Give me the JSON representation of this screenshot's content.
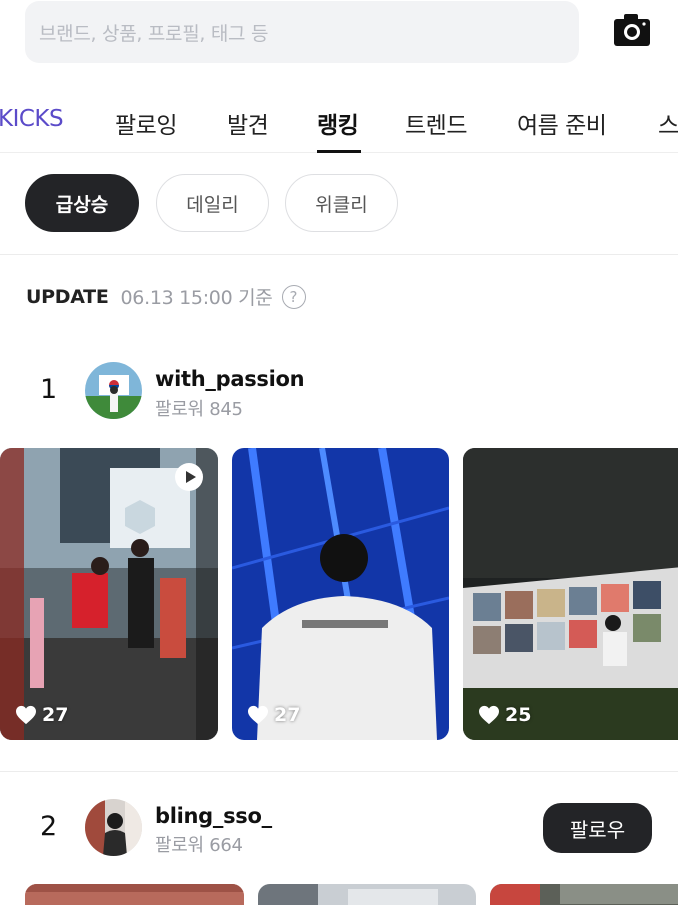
{
  "search": {
    "placeholder": "브랜드, 상품, 프로필, 태그 등"
  },
  "icons": {
    "camera": "camera-icon",
    "help": "question-circle-icon",
    "heart": "heart-icon",
    "play": "play-icon"
  },
  "tabs": [
    {
      "label": "KICKS"
    },
    {
      "label": "팔로잉"
    },
    {
      "label": "발견"
    },
    {
      "label": "랭킹"
    },
    {
      "label": "트렌드"
    },
    {
      "label": "여름 준비"
    },
    {
      "label": "스"
    }
  ],
  "active_tab": "랭킹",
  "filters": [
    {
      "label": "급상승"
    },
    {
      "label": "데일리"
    },
    {
      "label": "위클리"
    }
  ],
  "active_filter": "급상승",
  "update": {
    "label": "UPDATE",
    "time": "06.13 15:00 기준",
    "help_symbol": "?"
  },
  "rankings": [
    {
      "rank": "1",
      "username": "with_passion",
      "followers": "팔로워 845",
      "posts": [
        {
          "likes": "27"
        },
        {
          "likes": "27"
        },
        {
          "likes": "25"
        }
      ]
    },
    {
      "rank": "2",
      "username": "bling_sso_",
      "followers": "팔로워 664",
      "follow_label": "팔로우"
    }
  ],
  "colors": {
    "accent": "#5b4bc9",
    "dark": "#232427",
    "muted": "#9a9ca3"
  }
}
